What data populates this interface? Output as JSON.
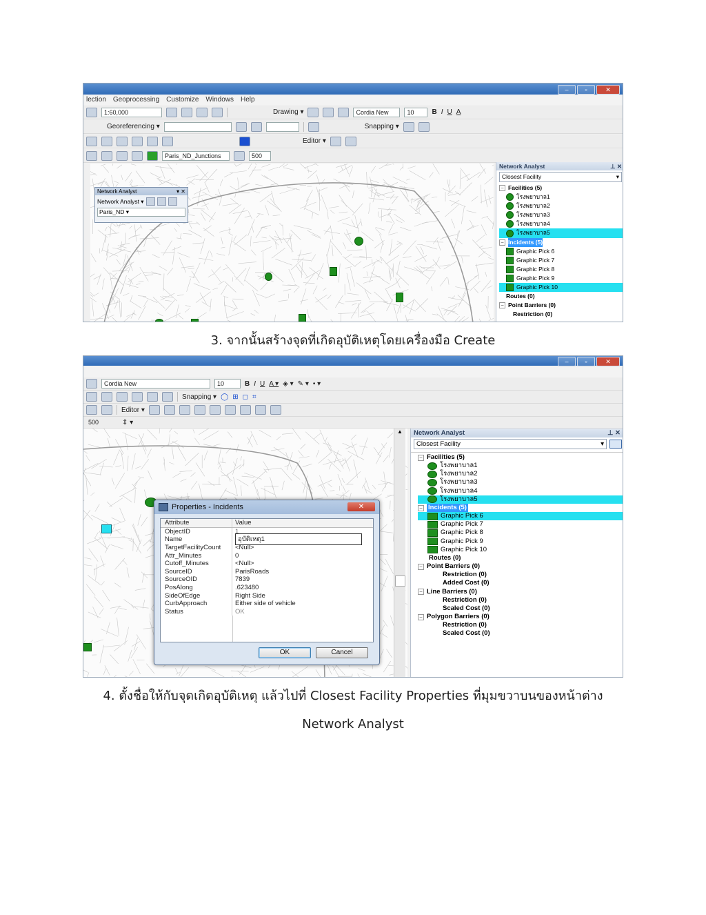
{
  "screenshot1": {
    "menu": [
      "lection",
      "Geoprocessing",
      "Customize",
      "Windows",
      "Help"
    ],
    "scale_combo": "1:60,000",
    "georeferencing_label": "Georeferencing ▾",
    "drawing_label": "Drawing ▾",
    "font_combo": "Cordia New",
    "font_size": "10",
    "snapping_label": "Snapping ▾",
    "editor_label": "Editor ▾",
    "layer_combo": "Paris_ND_Junctions",
    "float_window": {
      "title": "Network Analyst",
      "menu_label": "Network Analyst ▾",
      "dataset": "Paris_ND"
    },
    "panel": {
      "title": "Network Analyst",
      "dropdown": "Closest Facility",
      "facilities_header": "Facilities (5)",
      "facilities": [
        "โรงพยาบาล1",
        "โรงพยาบาล2",
        "โรงพยาบาล3",
        "โรงพยาบาล4",
        "โรงพยาบาล5"
      ],
      "incidents_header": "Incidents (5)",
      "incidents": [
        "Graphic Pick 6",
        "Graphic Pick 7",
        "Graphic Pick 8",
        "Graphic Pick 9",
        "Graphic Pick 10"
      ],
      "routes": "Routes (0)",
      "point_barriers": "Point Barriers (0)",
      "restriction": "Restriction (0)"
    }
  },
  "caption1": "3. จากนั้นสร้างจุดที่เกิดอุบัติเหตุโดยเครื่องมือ Create",
  "screenshot2": {
    "font_combo": "Cordia New",
    "font_size": "10",
    "snapping_label": "Snapping ▾",
    "editor_label": "Editor ▾",
    "tolerance_value": "500",
    "panel": {
      "title": "Network Analyst",
      "dropdown": "Closest Facility",
      "facilities_header": "Facilities (5)",
      "facilities": [
        "โรงพยาบาล1",
        "โรงพยาบาล2",
        "โรงพยาบาล3",
        "โรงพยาบาล4",
        "โรงพยาบาล5"
      ],
      "incidents_header": "Incidents (5)",
      "incidents": [
        "Graphic Pick 6",
        "Graphic Pick 7",
        "Graphic Pick 8",
        "Graphic Pick 9",
        "Graphic Pick 10"
      ],
      "routes": "Routes (0)",
      "point_barriers": "Point Barriers (0)",
      "pb_restriction": "Restriction (0)",
      "pb_added_cost": "Added Cost (0)",
      "line_barriers": "Line Barriers (0)",
      "lb_restriction": "Restriction (0)",
      "lb_scaled_cost": "Scaled Cost (0)",
      "polygon_barriers": "Polygon Barriers (0)",
      "pg_restriction": "Restriction (0)",
      "pg_scaled_cost": "Scaled Cost (0)"
    },
    "dialog": {
      "title": "Properties - Incidents",
      "col_attribute": "Attribute",
      "col_value": "Value",
      "rows": [
        {
          "attr": "ObjectID",
          "value": "1"
        },
        {
          "attr": "Name",
          "value": "อุบัติเหตุ1"
        },
        {
          "attr": "TargetFacilityCount",
          "value": "<Null>"
        },
        {
          "attr": "Attr_Minutes",
          "value": "0"
        },
        {
          "attr": "Cutoff_Minutes",
          "value": "<Null>"
        },
        {
          "attr": "SourceID",
          "value": "ParisRoads"
        },
        {
          "attr": "SourceOID",
          "value": "7839"
        },
        {
          "attr": "PosAlong",
          "value": ".623480"
        },
        {
          "attr": "SideOfEdge",
          "value": "Right Side"
        },
        {
          "attr": "CurbApproach",
          "value": "Either side of vehicle"
        },
        {
          "attr": "Status",
          "value": "OK"
        }
      ],
      "ok": "OK",
      "cancel": "Cancel"
    }
  },
  "caption2_line1": "4. ตั้งชื่อให้กับจุดเกิดอุบัติเหตุ แล้วไปที่ Closest Facility Properties ที่มุมขวาบนของหน้าต่าง",
  "caption2_line2": "Network Analyst",
  "colors": {
    "highlight": "#26e0f0",
    "selected": "#3399ff",
    "marker": "#1e8f1e",
    "titlebar": "#2f6bb7"
  }
}
